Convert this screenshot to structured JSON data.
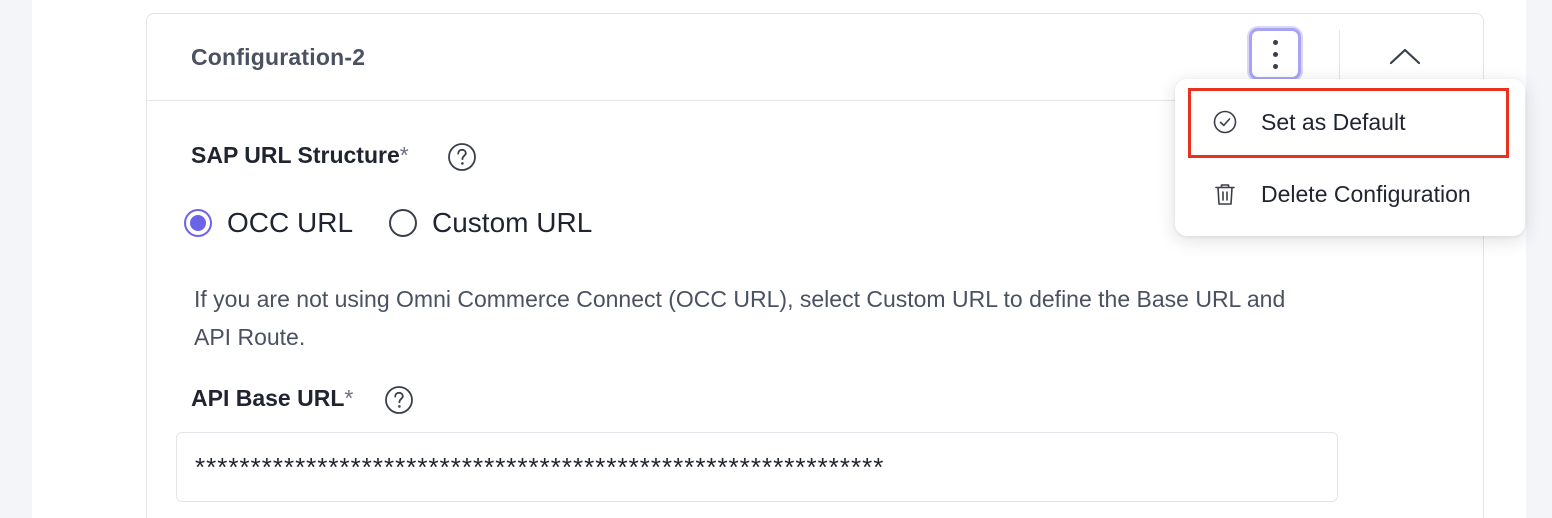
{
  "card": {
    "title": "Configuration-2"
  },
  "sap_url_structure": {
    "label": "SAP URL Structure",
    "required_mark": "*",
    "options": [
      {
        "label": "OCC URL",
        "selected": true
      },
      {
        "label": "Custom URL",
        "selected": false
      }
    ],
    "help_text": "If you are not using Omni Commerce Connect (OCC URL), select Custom URL to define the Base URL and API Route."
  },
  "api_base_url": {
    "label": "API Base URL",
    "required_mark": "*",
    "value": "**************************************************************"
  },
  "menu": {
    "items": [
      {
        "label": "Set as Default",
        "icon": "check-circle-icon"
      },
      {
        "label": "Delete Configuration",
        "icon": "trash-icon"
      }
    ]
  },
  "colors": {
    "accent": "#6b63e8",
    "highlight": "#e8321e"
  }
}
